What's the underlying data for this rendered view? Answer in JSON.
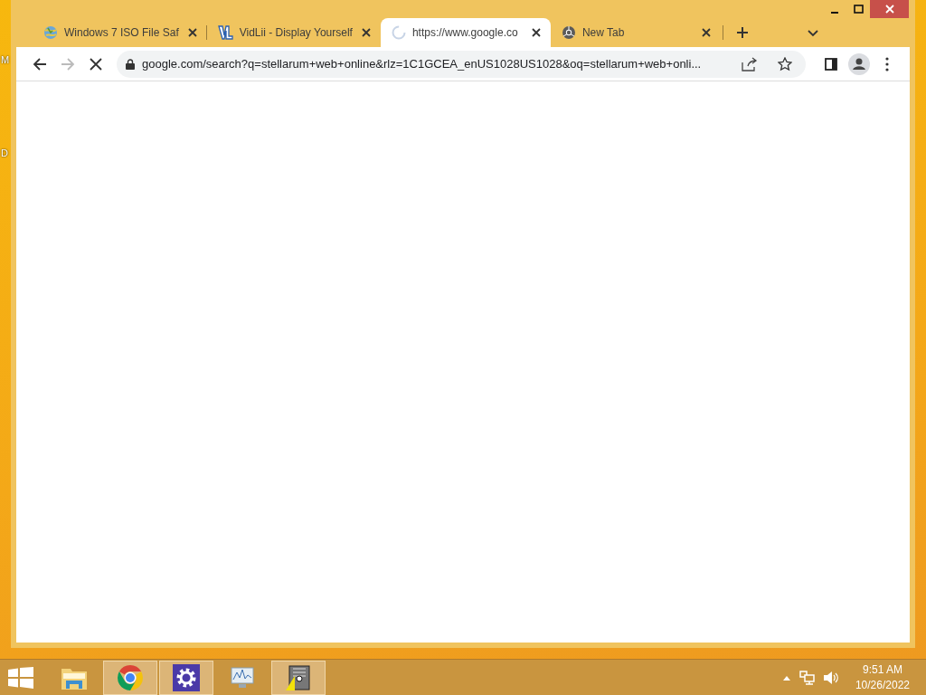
{
  "desktop_labels": [
    "M",
    "D"
  ],
  "window": {
    "tabs": [
      {
        "kind": "globe",
        "title": "Windows 7 ISO File Saf",
        "selected": false
      },
      {
        "kind": "vidlii",
        "title": "VidLii - Display Yourself",
        "selected": false
      },
      {
        "kind": "loading",
        "title": "https://www.google.co",
        "selected": true
      },
      {
        "kind": "chrome",
        "title": "New Tab",
        "selected": false
      }
    ],
    "address_bar": {
      "url": "google.com/search?q=stellarum+web+online&rlz=1C1GCEA_enUS1028US1028&oq=stellarum+web+onli...",
      "loading": true
    }
  },
  "taskbar": {
    "items": [
      {
        "kind": "explorer",
        "running": false
      },
      {
        "kind": "chrome",
        "running": true
      },
      {
        "kind": "settings",
        "running": true
      },
      {
        "kind": "monitor",
        "running": false
      },
      {
        "kind": "app",
        "running": true
      }
    ],
    "clock": {
      "time": "9:51 AM",
      "date": "10/26/2022"
    }
  }
}
